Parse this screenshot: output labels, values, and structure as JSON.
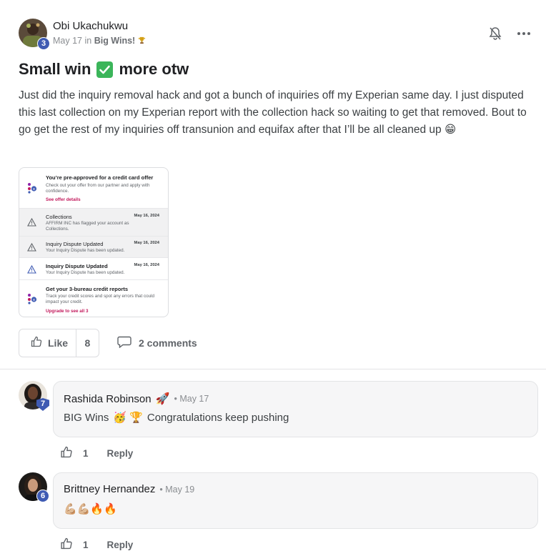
{
  "post": {
    "author": {
      "name": "Obi Ukachukwu",
      "level": "3"
    },
    "date": "May 17",
    "in_text": "in",
    "group": "Big Wins!",
    "title_part1": "Small win",
    "title_part2": "more otw",
    "body": "Just did the inquiry removal hack and got a bunch of inquiries off my Experian same day. I just disputed this last collection on my Experian report with the collection hack so waiting to get that removed. Bout to go get the rest of my inquiries off transunion and equifax after that I’ll be all cleaned up 😁",
    "attachment": {
      "offer": {
        "title": "You’re pre-approved for a credit card offer",
        "desc": "Check out your offer from our partner and apply with confidence.",
        "link": "See offer details"
      },
      "alerts": [
        {
          "title": "Collections",
          "desc": "AFFIRM INC has flagged your account as Collections.",
          "date": "May 16, 2024"
        },
        {
          "title": "Inquiry Dispute Updated",
          "desc": "Your Inquiry Dispute has been updated.",
          "date": "May 16, 2024"
        },
        {
          "title": "Inquiry Dispute Updated",
          "desc": "Your Inquiry Dispute has been updated.",
          "date": "May 16, 2024"
        }
      ],
      "reports": {
        "title": "Get your 3-bureau credit reports",
        "desc": "Track your credit scores and spot any errors that could impact your credit.",
        "link": "Upgrade to see all 3"
      }
    },
    "like_label": "Like",
    "like_count": "8",
    "comments_label": "2 comments"
  },
  "comments": [
    {
      "name": "Rashida Robinson",
      "name_emoji": "🚀",
      "date": "• May 17",
      "level": "7",
      "text_emoji": "🥳 🏆",
      "text": "Congratulations keep pushing",
      "text_prefix": "BIG Wins",
      "likes": "1",
      "reply": "Reply"
    },
    {
      "name": "Brittney Hernandez",
      "date": "• May 19",
      "level": "6",
      "text": "💪🏼💪🏼🔥🔥",
      "likes": "1",
      "reply": "Reply"
    }
  ],
  "colors": {
    "badge": "#3f5bb3",
    "check": "#3bb55a",
    "link": "#c2185b"
  },
  "icons": [
    "bell-icon",
    "more-icon",
    "check-icon",
    "thumbs-up-icon",
    "comment-icon",
    "trophy-icon",
    "warning-icon"
  ]
}
